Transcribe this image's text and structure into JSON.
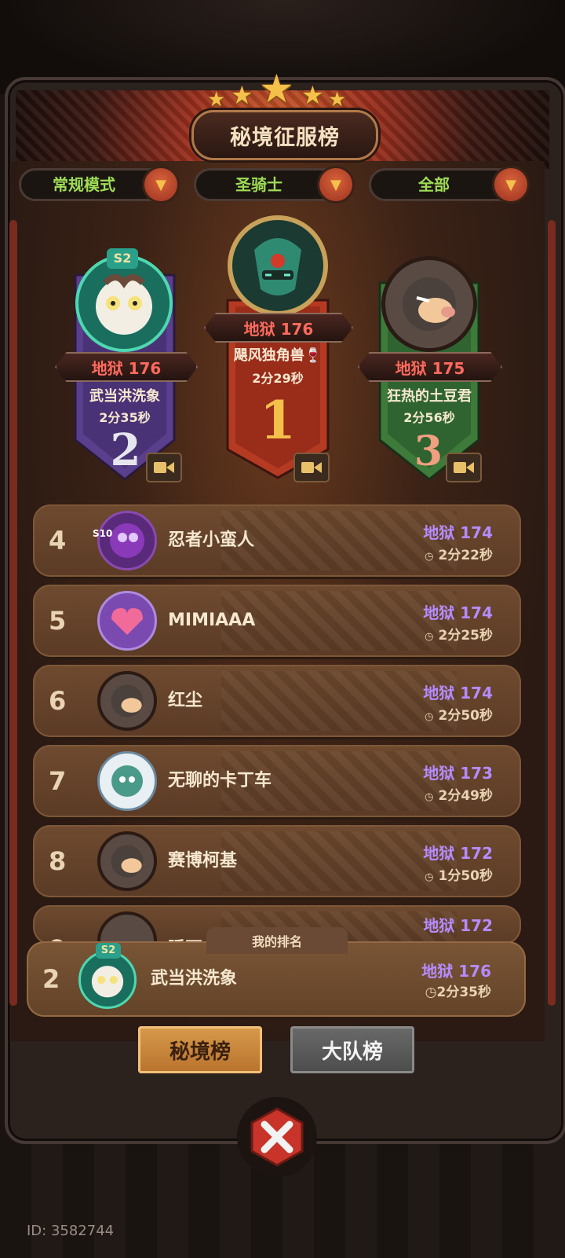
{
  "header": {
    "title": "秘境征服榜"
  },
  "filters": [
    {
      "label": "常规模式"
    },
    {
      "label": "圣骑士"
    },
    {
      "label": "全部"
    }
  ],
  "podium": {
    "first": {
      "rank": "1",
      "level": "地狱 176",
      "name": "飓风独角兽🍷",
      "time": "2分29秒"
    },
    "second": {
      "rank": "2",
      "level": "地狱 176",
      "name": "武当洪洗象",
      "time": "2分35秒",
      "season_badge": "S2"
    },
    "third": {
      "rank": "3",
      "level": "地狱 175",
      "name": "狂热的土豆君",
      "time": "2分56秒"
    }
  },
  "list": [
    {
      "rank": "4",
      "name": "忍者小蛮人",
      "level": "地狱 174",
      "time": "2分22秒",
      "badge": "S10"
    },
    {
      "rank": "5",
      "name": "MIMIAAA",
      "level": "地狱 174",
      "time": "2分25秒"
    },
    {
      "rank": "6",
      "name": "红尘",
      "level": "地狱 174",
      "time": "2分50秒"
    },
    {
      "rank": "7",
      "name": "无聊的卡丁车",
      "level": "地狱 173",
      "time": "2分49秒"
    },
    {
      "rank": "8",
      "name": "赛博柯基",
      "level": "地狱 172",
      "time": "1分50秒"
    },
    {
      "rank": "9",
      "name": "睡不",
      "level": "地狱 172",
      "time": ""
    }
  ],
  "my_rank": {
    "tab_label": "我的排名",
    "rank": "2",
    "name": "武当洪洗象",
    "level": "地狱 176",
    "time": "2分35秒",
    "season_badge": "S2"
  },
  "bottom_tabs": {
    "active": "秘境榜",
    "inactive": "大队榜"
  },
  "footer": {
    "user_id": "ID: 3582744"
  },
  "colors": {
    "level_red": "#ff6a5e",
    "level_purple": "#b58cff",
    "filter_green": "#9edc56",
    "gold": "#f4c04a"
  }
}
